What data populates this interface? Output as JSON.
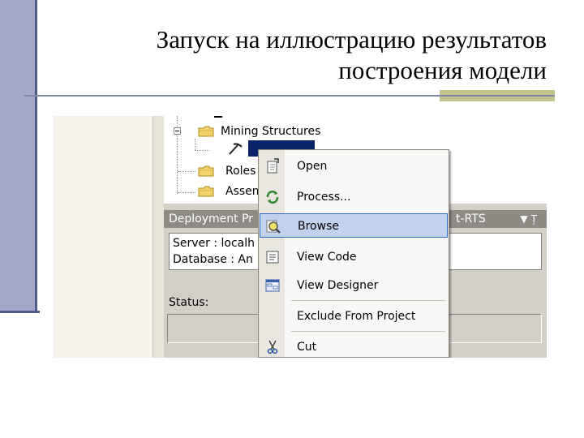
{
  "slide": {
    "title_line1": "Запуск на иллюстрацию результатов",
    "title_line2": "построения модели"
  },
  "tree": {
    "items": [
      {
        "label": "Mining Structures",
        "icon": "folder-icon"
      },
      {
        "label": "",
        "icon": "mining-model-icon"
      },
      {
        "label": "Roles",
        "icon": "folder-icon"
      },
      {
        "label": "Assemblies",
        "icon": "folder-icon"
      }
    ]
  },
  "deployment_panel": {
    "title": "Deployment Pr",
    "right_title": "t-RTS",
    "server_label": "Server :",
    "server_value": "localh",
    "database_label": "Database :",
    "database_value": "An",
    "status_label": "Status:"
  },
  "context_menu": {
    "items": [
      {
        "label": "Open",
        "icon": "open-document-icon",
        "highlighted": false
      },
      {
        "label": "Process...",
        "icon": "process-icon",
        "highlighted": false
      },
      {
        "label": "Browse",
        "icon": "browse-magnifier-icon",
        "highlighted": true
      },
      {
        "label": "View Code",
        "icon": "view-code-icon",
        "highlighted": false
      },
      {
        "label": "View Designer",
        "icon": "view-designer-icon",
        "highlighted": false
      },
      {
        "label": "Exclude From Project",
        "icon": "",
        "highlighted": false
      },
      {
        "label": "Cut",
        "icon": "scissors-icon",
        "highlighted": false
      }
    ]
  },
  "colors": {
    "slide_bar": "#a5a8c8",
    "slide_bar_border": "#4f5a8a",
    "title_accent": "#c2c38d",
    "menu_highlight": "#c1d2ee",
    "menu_highlight_border": "#316ac5",
    "panel_header": "#8e8b84"
  }
}
